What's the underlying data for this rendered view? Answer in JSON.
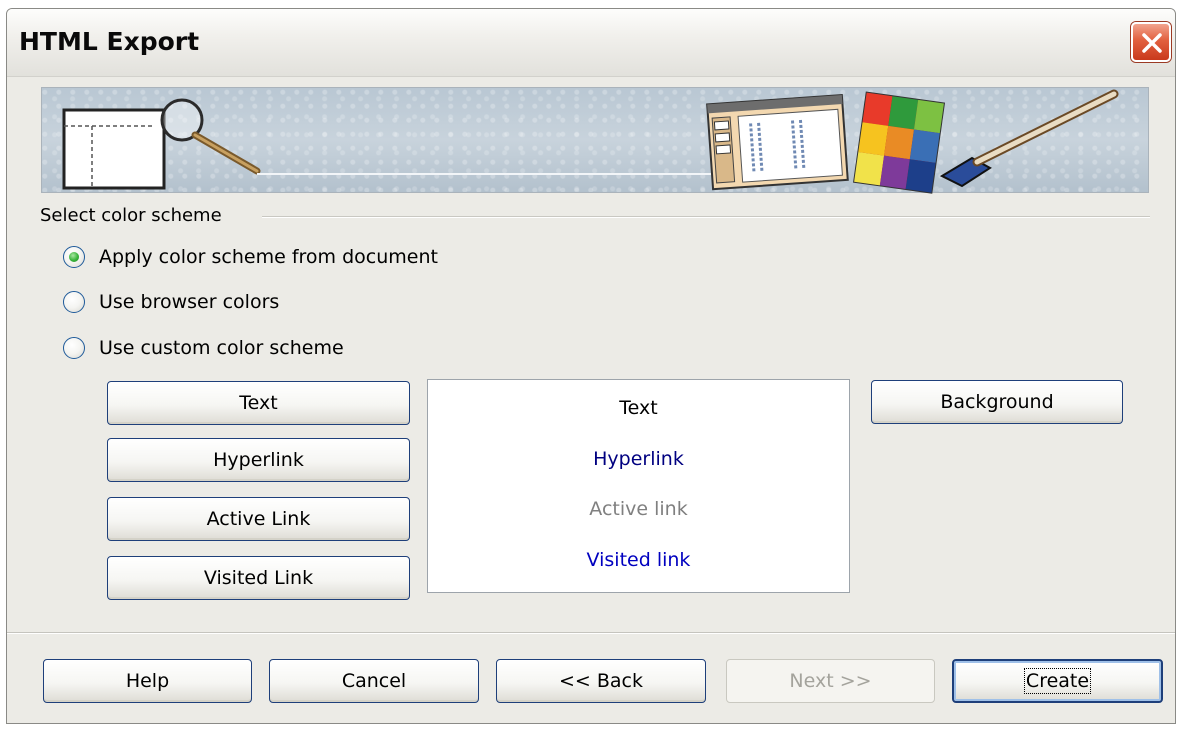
{
  "window": {
    "title": "HTML Export"
  },
  "section": {
    "label": "Select color scheme"
  },
  "radios": [
    {
      "label": "Apply color scheme from document",
      "checked": true
    },
    {
      "label": "Use browser colors",
      "checked": false
    },
    {
      "label": "Use custom color scheme",
      "checked": false
    }
  ],
  "color_buttons": {
    "text": "Text",
    "hyperlink": "Hyperlink",
    "active_link": "Active Link",
    "visited_link": "Visited Link",
    "background": "Background"
  },
  "preview": {
    "text": "Text",
    "hyperlink": "Hyperlink",
    "active_link": "Active link",
    "visited_link": "Visited link",
    "colors": {
      "text": "#000000",
      "hyperlink": "#000080",
      "active_link": "#808080",
      "visited_link": "#0000c0"
    }
  },
  "footer": {
    "help": "Help",
    "cancel": "Cancel",
    "back": "<< Back",
    "next": "Next >>",
    "create": "Create"
  }
}
